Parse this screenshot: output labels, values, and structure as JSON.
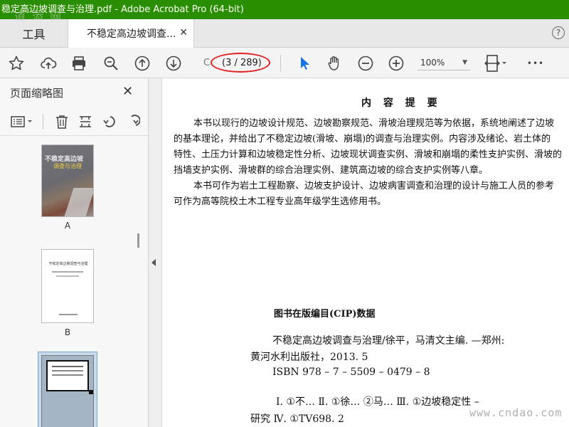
{
  "window": {
    "title": "稳定高边坡调查与治理.pdf - Adobe Acrobat Pro (64-bit)",
    "watermark_top": "道 添 网"
  },
  "tabs": {
    "tools_label": "工具",
    "doc_label": "不稳定高边坡调查...",
    "close_glyph": "✕",
    "help_glyph": "?"
  },
  "toolbar": {
    "page_current": "(3 / 289)",
    "page_prefix": "C",
    "zoom_value": "100%",
    "more_glyph": "•••"
  },
  "sidebar": {
    "title": "页面缩略图",
    "close_glyph": "✕",
    "thumbnails": [
      {
        "label": "A",
        "cover_title": "不稳定高边坡",
        "cover_sub": "调查与治理"
      },
      {
        "label": "B",
        "page_title": "不稳定高边坡调查与治理"
      },
      {
        "label": ""
      }
    ]
  },
  "document": {
    "summary_heading": "内 容 提 要",
    "paragraphs": [
      "本书以现行的边坡设计规范、边坡勘察规范、滑坡治理规范等为依据，系统地阐述了边坡",
      "的基本理论，并给出了不稳定边坡(滑坡、崩塌)的调查与治理实例。内容涉及绪论、岩土体的",
      "特性、土压力计算和边坡稳定性分析、边坡现状调查实例、滑坡和崩塌的柔性支护实例、滑坡的",
      "挡墙支护实例、滑坡群的综合治理实例、建筑高边坡的综合支护实例等八章。",
      "本书可作为岩土工程勘察、边坡支护设计、边坡病害调查和治理的设计与施工人员的参考",
      "可作为高等院校土木工程专业高年级学生选修用书。"
    ],
    "cip_title": "图书在版编目(CIP)数据",
    "cip_lines": [
      "不稳定高边坡调查与治理/徐平，马清文主编. —郑州:",
      "黄河水利出版社，2013. 5",
      "ISBN 978 – 7 – 5509 – 0479 – 8",
      "Ⅰ. ①不…  Ⅱ. ①徐…  ②马…   Ⅲ. ①边坡稳定性 –",
      "研究   Ⅳ. ①TV698. 2"
    ]
  },
  "footer_watermark": "www.cndao.com",
  "colors": {
    "titlebar": "#2a8f00",
    "accent_blue": "#1473e6",
    "annotation_red": "#e02020"
  },
  "icons": [
    "bookmark-star-icon",
    "cloud-upload-icon",
    "print-icon",
    "zoom-search-icon",
    "page-up-icon",
    "page-down-icon",
    "select-arrow-icon",
    "hand-tool-icon",
    "zoom-out-icon",
    "zoom-in-icon",
    "fit-page-icon",
    "more-icon"
  ]
}
